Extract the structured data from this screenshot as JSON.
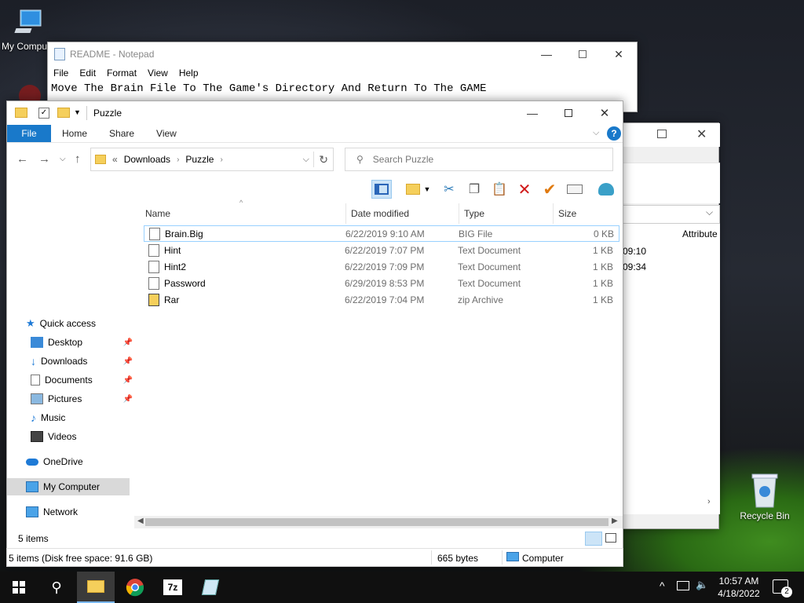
{
  "desktop": {
    "my_computer_label": "My Comput",
    "recycle_bin_label": "Recycle Bin"
  },
  "notepad": {
    "title": "README - Notepad",
    "menu": [
      "File",
      "Edit",
      "Format",
      "View",
      "Help"
    ],
    "content": "Move The Brain File To The Game's Directory And Return To The GAME"
  },
  "background_window": {
    "column_attributes": "Attribute",
    "time_1": "09:10",
    "time_2": "09:34"
  },
  "explorer": {
    "title": "Puzzle",
    "ribbon_tabs": [
      "File",
      "Home",
      "Share",
      "View"
    ],
    "address": {
      "prefix": "«",
      "crumbs": [
        "Downloads",
        "Puzzle"
      ]
    },
    "search_placeholder": "Search Puzzle",
    "columns": {
      "name": "Name",
      "date": "Date modified",
      "type": "Type",
      "size": "Size"
    },
    "files": [
      {
        "name": "Brain.Big",
        "date": "6/22/2019 9:10 AM",
        "type": "BIG File",
        "size": "0 KB"
      },
      {
        "name": "Hint",
        "date": "6/22/2019 7:07 PM",
        "type": "Text Document",
        "size": "1 KB"
      },
      {
        "name": "Hint2",
        "date": "6/22/2019 7:09 PM",
        "type": "Text Document",
        "size": "1 KB"
      },
      {
        "name": "Password",
        "date": "6/29/2019 8:53 PM",
        "type": "Text Document",
        "size": "1 KB"
      },
      {
        "name": "Rar",
        "date": "6/22/2019 7:04 PM",
        "type": "zip Archive",
        "size": "1 KB"
      }
    ],
    "nav": {
      "quick_access": "Quick access",
      "desktop": "Desktop",
      "downloads": "Downloads",
      "documents": "Documents",
      "pictures": "Pictures",
      "music": "Music",
      "videos": "Videos",
      "onedrive": "OneDrive",
      "my_computer": "My Computer",
      "network": "Network"
    },
    "item_count": "5 items",
    "status_left": "5 items (Disk free space: 91.6 GB)",
    "status_size": "665 bytes",
    "status_location": "Computer"
  },
  "taskbar": {
    "time": "10:57 AM",
    "date": "4/18/2022",
    "notification_count": "2",
    "sevenzip_label": "7z"
  },
  "colors": {
    "accent": "#1979ca",
    "selection_border": "#99d1ff",
    "taskbar": "#101010"
  }
}
